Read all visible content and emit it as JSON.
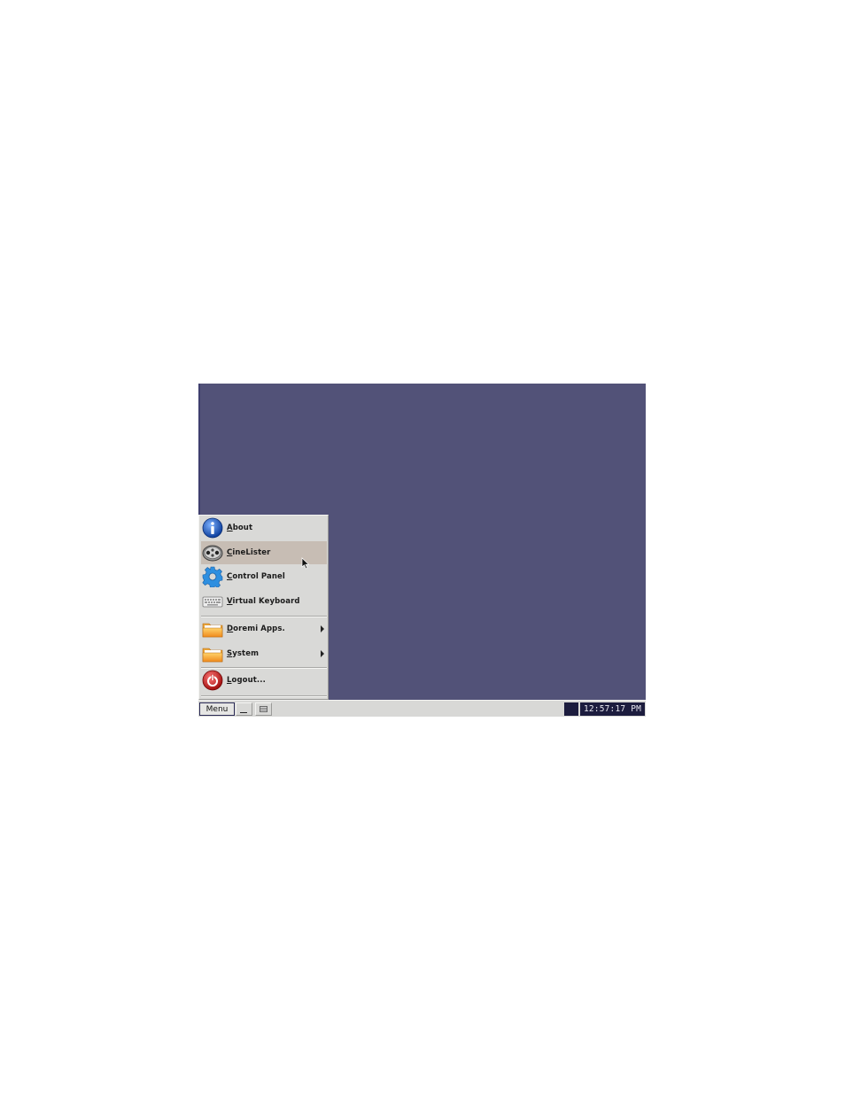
{
  "menu": {
    "items": [
      {
        "label": "About",
        "icon": "info-icon"
      },
      {
        "label": "CineLister",
        "icon": "film-reel-icon"
      },
      {
        "label": "Control Panel",
        "icon": "gear-icon"
      },
      {
        "label": "Virtual Keyboard",
        "icon": "keyboard-icon"
      },
      {
        "label": "Doremi Apps.",
        "icon": "folder-icon",
        "submenu": true
      },
      {
        "label": "System",
        "icon": "folder-icon",
        "submenu": true
      },
      {
        "label": "Logout...",
        "icon": "power-icon"
      }
    ],
    "highlighted": "CineLister"
  },
  "taskbar": {
    "menu_label": "Menu",
    "clock": "12:57:17 PM"
  },
  "colors": {
    "desktop": "#525278",
    "menu_bg": "#d9d9d7",
    "highlight": "#c7bdb4",
    "tray": "#1c1c3e"
  }
}
